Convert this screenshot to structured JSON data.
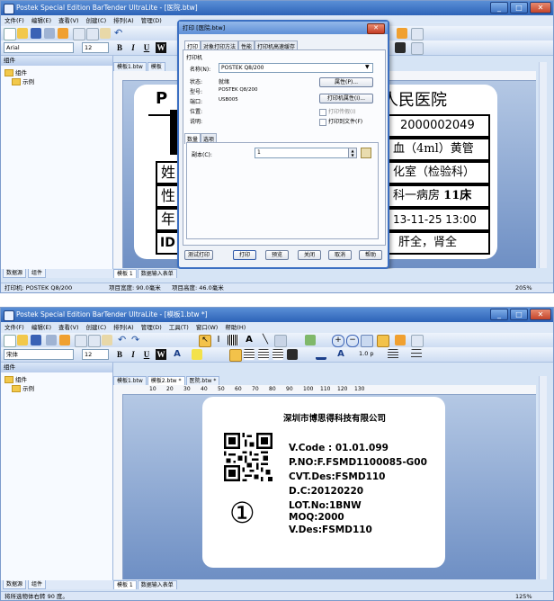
{
  "shot1": {
    "window_title": "Postek Special Edition BarTender UltraLite - [医院.btw]",
    "menu": [
      "文件(F)",
      "编辑(E)",
      "查看(V)",
      "创建(C)",
      "排列(A)",
      "管理(D)"
    ],
    "font_name": "Arial",
    "font_size": "12",
    "format_buttons": [
      "B",
      "I",
      "U",
      "W"
    ],
    "panel_title": "组件",
    "tree": [
      "组件",
      "示例"
    ],
    "doc_tabs": [
      "模板1.btw",
      "模板"
    ],
    "bottom_tabs": [
      "数据源",
      "组件"
    ],
    "view_tabs": [
      "模板 1",
      "数据输入表单"
    ],
    "status": {
      "printer": "打印机: POSTEK Q8/200",
      "item_width": "项目宽度: 90.0毫米",
      "item_height": "项目高度: 46.0毫米",
      "zoom": "205%"
    },
    "label": {
      "hospital": "人民医院",
      "p_letter": "P",
      "barcode_no": "2000002049",
      "sample": "血（4ml）黄管",
      "dept": "化室（检验科）",
      "ward_prefix": "科一病房",
      "bed": "11床",
      "datetime": "13-11-25 13:00",
      "tests": "肝全，肾全",
      "left_chars": [
        "姓",
        "性",
        "年",
        "ID"
      ]
    },
    "dialog": {
      "title": "打印 [医院.btw]",
      "tabs": [
        "打印",
        "对象打印方法",
        "性能",
        "打印机高速缓存"
      ],
      "section_printer": "打印机",
      "name_label": "名称(N):",
      "name_value": "POSTEK Q8/200",
      "status_label": "状态:",
      "status_value": "就绪",
      "type_label": "型号:",
      "type_value": "POSTEK Q8/200",
      "port_label": "端口:",
      "port_value": "USB005",
      "location_label": "位置:",
      "comment_label": "说明:",
      "properties_button": "属性(P)...",
      "printer_props_button": "打印机属性(I)...",
      "print_preview_check": "打印传假(I)",
      "print_to_file_check": "打印到文件(F)",
      "sub_tabs": [
        "数量",
        "选项"
      ],
      "copies_label": "副本(C):",
      "copies_value": "1",
      "buttons": [
        "测试打印",
        "打印",
        "预览",
        "关闭",
        "取消",
        "帮助"
      ]
    }
  },
  "shot2": {
    "window_title": "Postek Special Edition BarTender UltraLite - [模板1.btw *]",
    "menu": [
      "文件(F)",
      "编辑(E)",
      "查看(V)",
      "创建(C)",
      "排列(A)",
      "管理(D)",
      "工具(T)",
      "窗口(W)",
      "帮助(H)"
    ],
    "font_name": "宋体",
    "font_size": "12",
    "format_buttons": [
      "B",
      "I",
      "U",
      "W"
    ],
    "line_width": "1.0 p",
    "panel_title": "组件",
    "tree": [
      "组件",
      "示例"
    ],
    "doc_tabs": [
      "模板1.btw",
      "模板2.btw *",
      "医院.btw *"
    ],
    "ruler": [
      "10",
      "20",
      "30",
      "40",
      "50",
      "60",
      "70",
      "80",
      "90",
      "100",
      "110",
      "120",
      "130"
    ],
    "bottom_tabs": [
      "数据源",
      "组件"
    ],
    "view_tabs": [
      "模板 1",
      "数据输入表单"
    ],
    "status": {
      "hint": "将所选物体右转 90 度。",
      "zoom": "125%"
    },
    "label": {
      "company": "深圳市博思得科技有限公司",
      "circle_number": "①",
      "lines": [
        "V.Code : 01.01.099",
        "P.NO:F.FSMD1100085-G00",
        "CVT.Des:FSMD110",
        "D.C:20120220",
        "LOT.No:1BNW",
        "MOQ:2000",
        "V.Des:FSMD110"
      ]
    }
  },
  "colors": {
    "title_bar": "#2d63b8",
    "workspace": "#6e8fc4",
    "label_bg": "#ffffff"
  }
}
